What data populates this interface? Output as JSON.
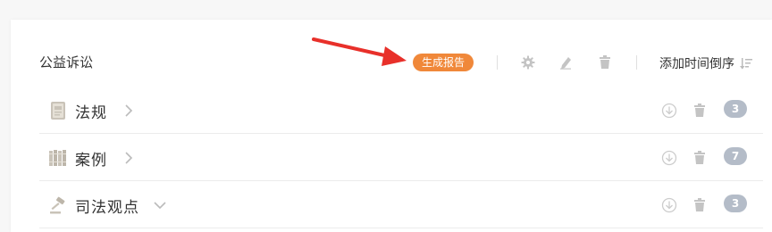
{
  "section": {
    "title": "公益诉讼",
    "generate_report_label": "生成报告",
    "sort_label": "添加时间倒序"
  },
  "colors": {
    "accent": "#f0883a",
    "badge": "#b4bcc8",
    "icon": "#c4c4c4",
    "arrow": "#e8302a"
  },
  "toolbar_icons": [
    "gear-icon",
    "edit-icon",
    "trash-icon",
    "sort-desc-icon"
  ],
  "rows": [
    {
      "label": "法规",
      "icon": "law-book-icon",
      "expand": "chevron-right-icon",
      "count": "3"
    },
    {
      "label": "案例",
      "icon": "case-files-icon",
      "expand": "chevron-right-icon",
      "count": "7"
    },
    {
      "label": "司法观点",
      "icon": "gavel-icon",
      "expand": "chevron-down-icon",
      "count": "3"
    }
  ]
}
